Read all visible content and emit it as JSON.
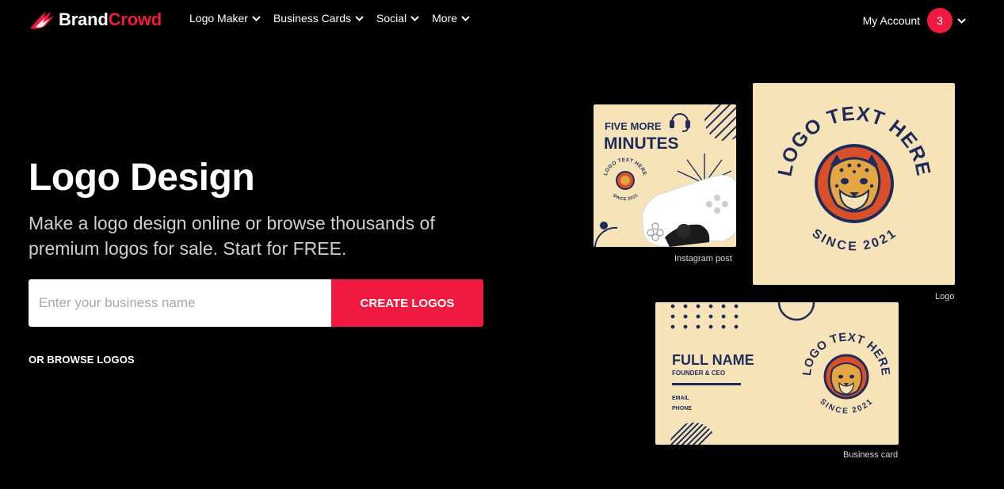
{
  "nav": {
    "brand": {
      "part1": "Brand",
      "part2": "Crowd",
      "icon": "brandcrowd-wing-logo"
    },
    "menu": [
      {
        "label": "Logo Maker"
      },
      {
        "label": "Business Cards"
      },
      {
        "label": "Social"
      },
      {
        "label": "More"
      }
    ],
    "account": {
      "label": "My Account",
      "badge_count": "3"
    }
  },
  "hero": {
    "title": "Logo Design",
    "subtitle": "Make a logo design online or browse thousands of premium logos for sale. Start for FREE.",
    "search": {
      "value": "",
      "placeholder": "Enter your business name"
    },
    "cta_label": "CREATE LOGOS",
    "browse_label": "OR BROWSE LOGOS"
  },
  "previews": {
    "instagram": {
      "caption": "Instagram post",
      "headline_1": "FIVE MORE",
      "headline_2": "MINUTES",
      "badge_top": "LOGO TEXT HERE",
      "badge_bottom": "SINCE 2021"
    },
    "logo": {
      "caption": "Logo",
      "ring_top": "LOGO TEXT HERE",
      "ring_bottom": "SINCE 2021"
    },
    "business_card": {
      "caption": "Business card",
      "full_name": "FULL NAME",
      "role": "FOUNDER & CEO",
      "line_1": "EMAIL",
      "line_2": "PHONE",
      "ring_top": "LOGO TEXT HERE",
      "ring_bottom": "SINCE 2021"
    }
  },
  "colors": {
    "accent": "#f0193f",
    "card_bg": "#f6e4b8",
    "navy": "#1f2c5a",
    "rust": "#d8502a"
  }
}
